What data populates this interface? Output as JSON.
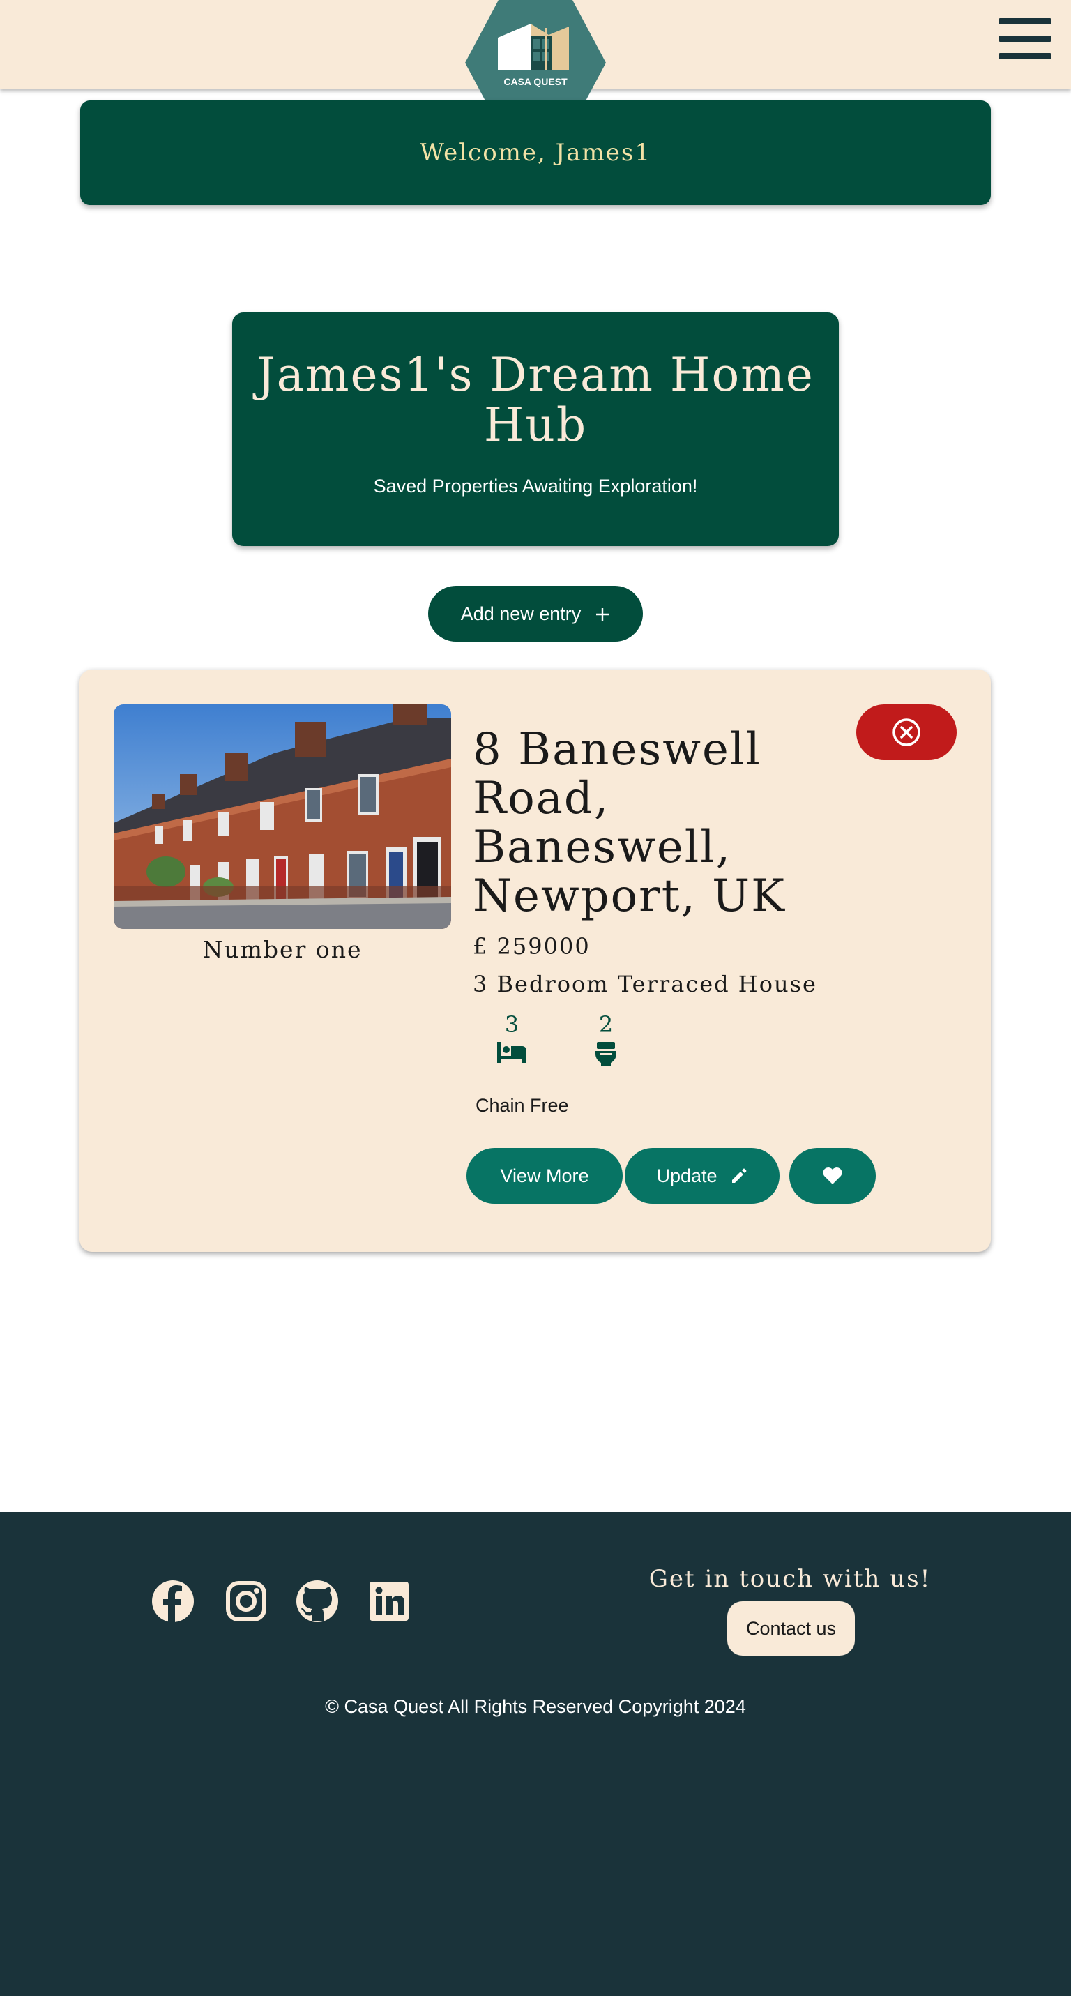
{
  "header": {
    "logo_text": "CASA QUEST",
    "menu_icon": "hamburger-menu-icon"
  },
  "welcome": {
    "text": "Welcome, James1"
  },
  "hub": {
    "title": "James1's Dream Home Hub",
    "subtitle": "Saved Properties Awaiting Exploration!"
  },
  "add_entry": {
    "label": "Add new entry",
    "icon": "plus-icon"
  },
  "property": {
    "image_caption": "Number one",
    "address": "8 Baneswell Road, Baneswell, Newport, UK",
    "price": "£ 259000",
    "type": "3 Bedroom Terraced House",
    "bedrooms": "3",
    "bathrooms": "2",
    "chain_status": "Chain Free",
    "view_more_label": "View More",
    "update_label": "Update",
    "icons": [
      "bed-icon",
      "toilet-icon",
      "pencil-icon",
      "heart-icon",
      "close-circle-icon"
    ]
  },
  "footer": {
    "social_icons": [
      "facebook-icon",
      "instagram-icon",
      "github-icon",
      "linkedin-icon"
    ],
    "cta_heading": "Get in touch with us!",
    "contact_label": "Contact us",
    "copyright": "© Casa Quest All Rights Reserved Copyright 2024"
  },
  "colors": {
    "cream": "#f9ead8",
    "dark_green": "#024d3c",
    "teal": "#077464",
    "logo_teal": "#3f7b78",
    "danger": "#c11b1b",
    "footer_bg": "#1a333a",
    "welcome_text": "#f2e2a6"
  }
}
